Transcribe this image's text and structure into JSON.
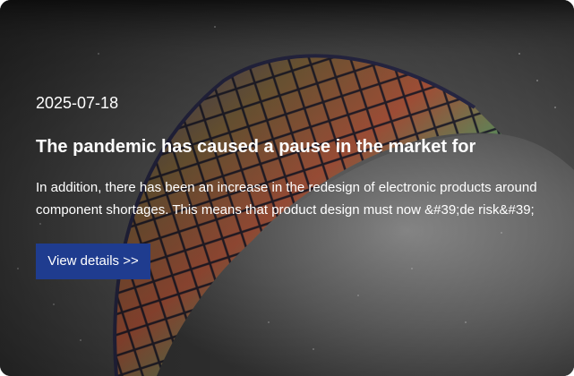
{
  "article": {
    "date": "2025-07-18",
    "title": "The pandemic has caused a pause in the market for",
    "excerpt_line1": "In addition, there has been an increase in the redesign of electronic products around",
    "excerpt_line2": "component shortages. This means that product design must now &#39;de risk&#39;",
    "button_label": "View details >>"
  },
  "colors": {
    "button_bg": "#1f3c8f",
    "text": "#ffffff"
  }
}
